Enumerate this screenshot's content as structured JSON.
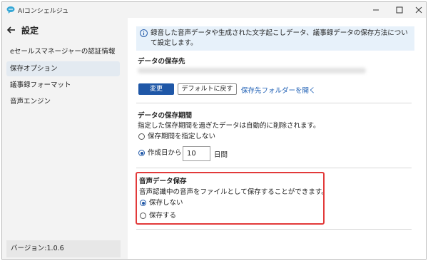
{
  "window": {
    "title": "AIコンシェルジュ",
    "controls": [
      "minimize-icon",
      "maximize-icon",
      "close-icon"
    ]
  },
  "sidebar": {
    "title": "設定",
    "items": [
      {
        "label": "eセールスマネージャーの認証情報",
        "active": false
      },
      {
        "label": "保存オプション",
        "active": true
      },
      {
        "label": "議事録フォーマット",
        "active": false
      },
      {
        "label": "音声エンジン",
        "active": false
      }
    ],
    "version": "バージョン:1.0.6"
  },
  "info": {
    "text": "録音した音声データや生成された文字起こしデータ、議事録データの保存方法について設定します。"
  },
  "save_location": {
    "title": "データの保存先",
    "change_button": "変更",
    "default_button": "デフォルトに戻す",
    "open_folder_link": "保存先フォルダーを開く"
  },
  "retention": {
    "title": "データの保存期間",
    "description": "指定した保存期間を過ぎたデータは自動的に削除されます。",
    "options": [
      {
        "label": "保存期間を指定しない",
        "checked": false
      },
      {
        "label": "作成日から",
        "checked": true
      }
    ],
    "days_value": "10",
    "days_unit": "日間"
  },
  "audio_save": {
    "title": "音声データ保存",
    "description": "音声認識中の音声をファイルとして保存することができます。",
    "options": [
      {
        "label": "保存しない",
        "checked": true
      },
      {
        "label": "保存する",
        "checked": false
      }
    ]
  },
  "colors": {
    "accent": "#1f57a7",
    "link": "#1a5cb3",
    "highlight": "#e23a3a",
    "info_bg": "#e7f1fa"
  }
}
